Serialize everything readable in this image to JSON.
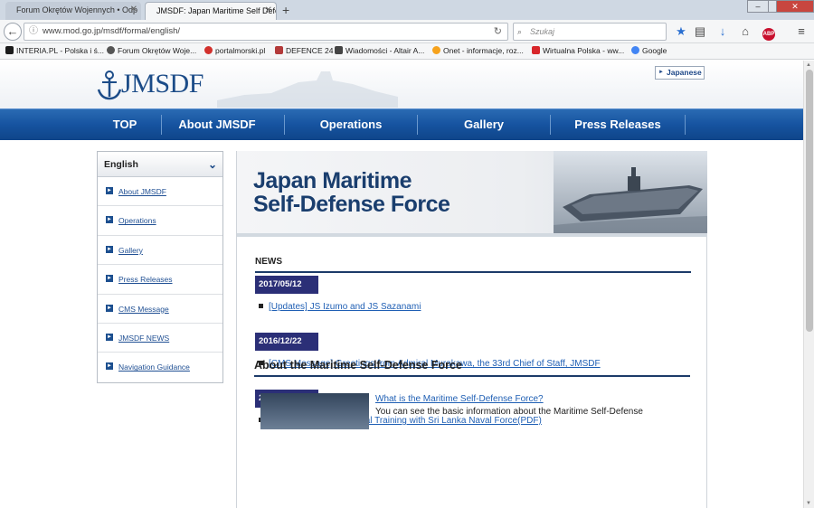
{
  "browser": {
    "tabs": [
      {
        "title": "Forum Okrętów Wojennych • Odp"
      },
      {
        "title": "JMSDF: Japan Maritime Self Defe"
      }
    ],
    "url": "www.mod.go.jp/msdf/formal/english/",
    "search_placeholder": "Szukaj",
    "bookmarks": [
      {
        "label": "INTERIA.PL - Polska i ś...",
        "color": "#1b1b1b"
      },
      {
        "label": "Forum Okrętów Woje...",
        "color": "#555555"
      },
      {
        "label": "portalmorski.pl",
        "color": "#d2312d"
      },
      {
        "label": "DEFENCE 24",
        "color": "#b33a3a"
      },
      {
        "label": "Wiadomości - Altair A...",
        "color": "#444444"
      },
      {
        "label": "Onet - informacje, roz...",
        "color": "#f6a21c"
      },
      {
        "label": "Wirtualna Polska - ww...",
        "color": "#d8262b"
      },
      {
        "label": "Google",
        "color": "#4285f4"
      }
    ]
  },
  "site": {
    "logo_text": "JMSDF",
    "japanese_label": "Japanese",
    "nav": [
      "TOP",
      "About JMSDF",
      "Operations",
      "Gallery",
      "Press Releases"
    ]
  },
  "sidebar": {
    "heading": "English",
    "items": [
      "About JMSDF",
      "Operations",
      "Gallery",
      "Press Releases",
      "CMS Message",
      "JMSDF NEWS",
      "Navigation Guidance"
    ]
  },
  "banner": {
    "title_line1": "Japan Maritime",
    "title_line2": "Self-Defense Force"
  },
  "news": {
    "heading": "NEWS",
    "entries": [
      {
        "date": "2017/05/12",
        "text": "[Updates] JS Izumo and JS Sazanami"
      },
      {
        "date": "2016/12/22",
        "text": "[CMS Message] Greetings from Admiral Murakawa, the 33rd Chief of Staff, JMSDF"
      },
      {
        "date": "2015/12/01",
        "text": "[Press Releases] Bilateral Training with Sri Lanka Naval Force(PDF) "
      }
    ]
  },
  "about": {
    "heading": "About the Maritime Self-Defense Force",
    "link": "What is the Maritime Self-Defense Force?",
    "desc": "You can see the basic information about the Maritime Self-Defense"
  }
}
